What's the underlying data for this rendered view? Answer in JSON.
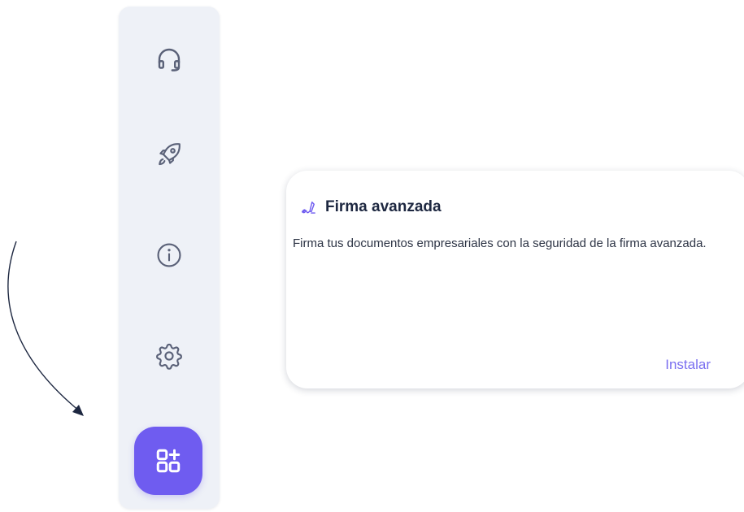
{
  "theme": {
    "accent": "#6f5cf0",
    "icon_color": "#5a6178",
    "link_color": "#7a6ff0",
    "sidebar_bg": "#eef1f7"
  },
  "sidebar": {
    "items": [
      {
        "icon": "headset-icon",
        "name": "support"
      },
      {
        "icon": "rocket-icon",
        "name": "getting-started"
      },
      {
        "icon": "info-icon",
        "name": "info"
      },
      {
        "icon": "gear-icon",
        "name": "settings"
      }
    ],
    "apps_button": {
      "icon": "apps-add-icon",
      "active": true
    }
  },
  "card": {
    "icon": "signature-icon",
    "title": "Firma avanzada",
    "description": "Firma tus documentos empresariales con la seguridad de la firma avanzada.",
    "action_label": "Instalar"
  },
  "annotation": {
    "icon": "curved-arrow-icon",
    "points_to": "apps-button"
  }
}
